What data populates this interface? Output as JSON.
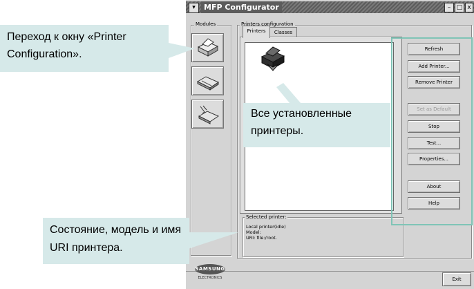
{
  "window": {
    "title": "MFP Configurator",
    "buttons": {
      "menu": "▾",
      "minimize": "–",
      "maximize": "□",
      "close": "x"
    }
  },
  "modules": {
    "label": "Modules",
    "items": [
      {
        "name": "printer-module",
        "icon": "printer-icon"
      },
      {
        "name": "scanner-module",
        "icon": "scanner-icon"
      },
      {
        "name": "port-module",
        "icon": "port-icon"
      }
    ],
    "logo": {
      "brand": "SAMSUNG",
      "sub": "ELECTRONICS"
    }
  },
  "printers_config": {
    "label": "Printers configuration",
    "tabs": [
      {
        "label": "Printers",
        "active": true
      },
      {
        "label": "Classes",
        "active": false
      }
    ],
    "buttons": [
      {
        "label": "Refresh",
        "enabled": true
      },
      {
        "label": "Add Printer...",
        "enabled": true
      },
      {
        "label": "Remove Printer",
        "enabled": true
      },
      {
        "label": "Set as Default",
        "enabled": false
      },
      {
        "label": "Stop",
        "enabled": true
      },
      {
        "label": "Test...",
        "enabled": true
      },
      {
        "label": "Properties...",
        "enabled": true
      },
      {
        "label": "About",
        "enabled": true
      },
      {
        "label": "Help",
        "enabled": true
      }
    ],
    "selected": {
      "label": "Selected printer:",
      "lines": [
        "Local printer(idle)",
        "Model:",
        "URI: file:/root."
      ]
    }
  },
  "exit_label": "Exit",
  "callouts": {
    "top": "Переход к окну «Printer Configuration».",
    "middle": "Все установленные принтеры.",
    "bottom": "Состояние, модель и имя URI принтера."
  },
  "colors": {
    "callout_bg": "#d6e9e9",
    "highlight_border": "#7fc4b6",
    "window_bg": "#d4d4d4"
  }
}
